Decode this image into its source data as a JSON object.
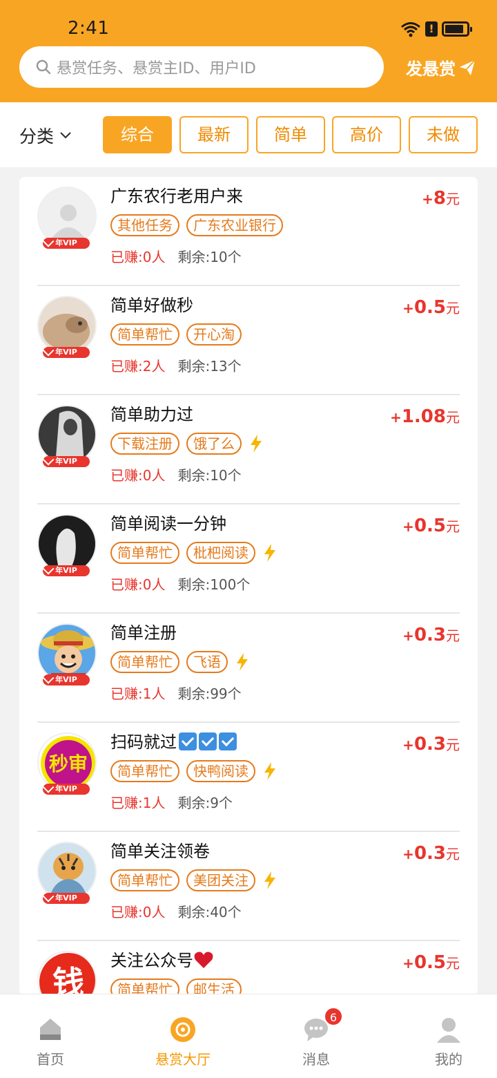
{
  "status_bar": {
    "time": "2:41"
  },
  "header": {
    "search_placeholder": "悬赏任务、悬赏主ID、用户ID",
    "post_bounty_label": "发悬赏",
    "brand_color": "#f9a524"
  },
  "filter": {
    "category_label": "分类",
    "tabs": [
      "综合",
      "最新",
      "简单",
      "高价",
      "未做"
    ],
    "active_tab": "综合"
  },
  "tasks": [
    {
      "title": "广东农行老用户来",
      "tags": [
        "其他任务",
        "广东农业银行"
      ],
      "fast": false,
      "earned": "已赚:0人",
      "remain": "剩余:10个",
      "price": "8",
      "avatar": "default-avatar"
    },
    {
      "title": "简单好做秒",
      "tags": [
        "简单帮忙",
        "开心淘"
      ],
      "fast": false,
      "earned": "已赚:2人",
      "remain": "剩余:13个",
      "price": "0.5",
      "avatar": "cat-avatar"
    },
    {
      "title": "简单助力过",
      "tags": [
        "下载注册",
        "饿了么"
      ],
      "fast": true,
      "earned": "已赚:0人",
      "remain": "剩余:10个",
      "price": "1.08",
      "avatar": "hoodie-avatar"
    },
    {
      "title": "简单阅读一分钟",
      "tags": [
        "简单帮忙",
        "枇杷阅读"
      ],
      "fast": true,
      "earned": "已赚:0人",
      "remain": "剩余:100个",
      "price": "0.5",
      "avatar": "dark-avatar"
    },
    {
      "title": "简单注册",
      "tags": [
        "简单帮忙",
        "飞语"
      ],
      "fast": true,
      "earned": "已赚:1人",
      "remain": "剩余:99个",
      "price": "0.3",
      "avatar": "cartoon-avatar"
    },
    {
      "title": "扫码就过",
      "title_checks": 3,
      "tags": [
        "简单帮忙",
        "快鸭阅读"
      ],
      "fast": true,
      "earned": "已赚:1人",
      "remain": "剩余:9个",
      "price": "0.3",
      "avatar": "seal-avatar",
      "avatar_text": "秒审"
    },
    {
      "title": "简单关注领卷",
      "tags": [
        "简单帮忙",
        "美团关注"
      ],
      "fast": true,
      "earned": "已赚:0人",
      "remain": "剩余:40个",
      "price": "0.3",
      "avatar": "tiger-avatar"
    },
    {
      "title": "关注公众号",
      "title_heart": true,
      "tags": [
        "简单帮忙",
        "邮生活"
      ],
      "fast": false,
      "earned": "",
      "remain": "",
      "price": "0.5",
      "avatar": "money-avatar",
      "avatar_text": "钱"
    }
  ],
  "labels": {
    "vip": "年VIP",
    "plus": "+",
    "currency": "元"
  },
  "bottom_nav": [
    {
      "label": "首页",
      "icon": "home-icon",
      "active": false
    },
    {
      "label": "悬赏大厅",
      "icon": "bounty-hall-icon",
      "active": true
    },
    {
      "label": "消息",
      "icon": "message-icon",
      "active": false,
      "badge": "6"
    },
    {
      "label": "我的",
      "icon": "profile-icon",
      "active": false
    }
  ]
}
